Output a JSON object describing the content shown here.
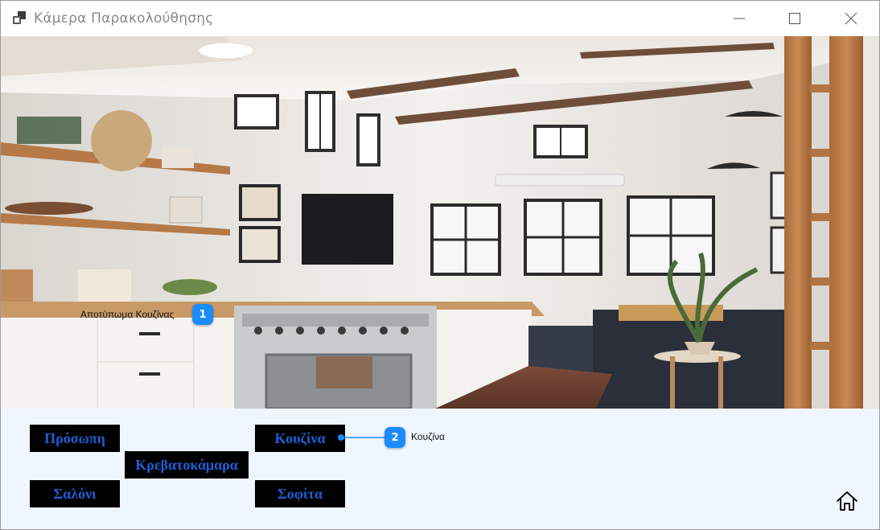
{
  "window": {
    "title": "Κάμερα Παρακολούθησης"
  },
  "camera": {
    "view_label": "Αποτύπωμα Κουζίνας",
    "callout_number": "1"
  },
  "rooms": {
    "facade": "Πρόσωπη",
    "bedroom": "Κρεβατοκάμαρα",
    "living_room": "Σαλόνι",
    "kitchen": "Κουζίνα",
    "attic": "Σοφίτα"
  },
  "kitchen_callout": {
    "number": "2",
    "label": "Κουζίνα"
  },
  "icons": {
    "app": "app-window-icon",
    "minimize": "minimize-icon",
    "maximize": "maximize-icon",
    "close": "close-icon",
    "home": "home-icon"
  },
  "colors": {
    "accent": "#1a8cff",
    "room_button_bg": "#000000",
    "room_button_text": "#1f5fd6",
    "panel_bg": "#f0f6ff"
  }
}
